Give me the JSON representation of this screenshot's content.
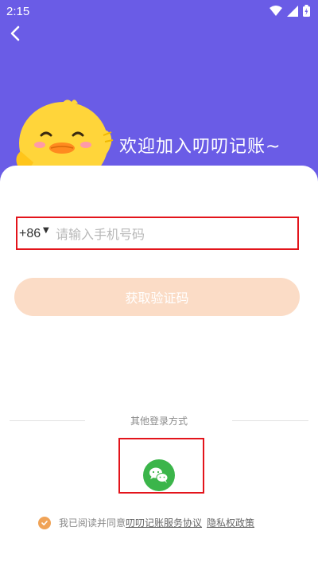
{
  "status": {
    "time": "2:15"
  },
  "header": {
    "welcome": "欢迎加入叨叨记账~"
  },
  "form": {
    "country_code": "+86",
    "phone_placeholder": "请输入手机号码",
    "get_code_label": "获取验证码"
  },
  "other_login": {
    "label": "其他登录方式",
    "wechat_icon": "wechat-icon"
  },
  "agreement": {
    "prefix": "我已阅读并同意",
    "service_link": "叨叨记账服务协议",
    "privacy_link": "隐私权政策"
  },
  "colors": {
    "header_bg": "#6a5ce6",
    "button_bg": "#fbdcc6",
    "wechat_green": "#3bb54a",
    "check_orange": "#f0a357",
    "highlight_red": "#e3141b"
  }
}
